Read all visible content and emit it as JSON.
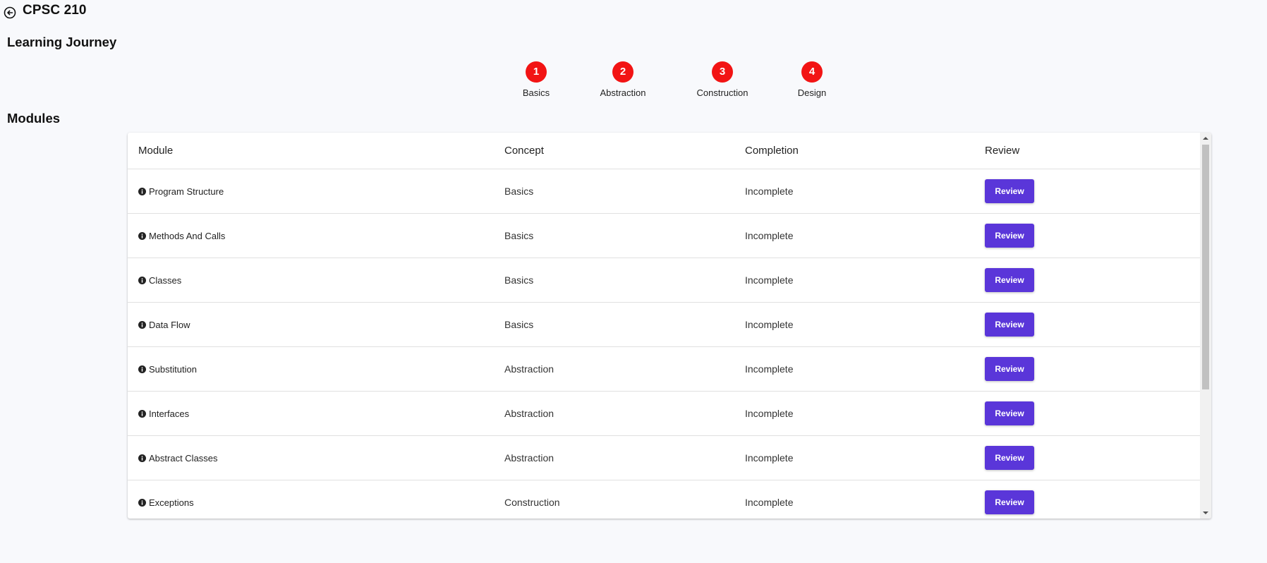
{
  "header": {
    "course_title": "CPSC 210",
    "back_icon": "back-arrow-circle-icon"
  },
  "journey": {
    "title": "Learning Journey",
    "step_color": "#f21414",
    "steps": [
      {
        "number": "1",
        "label": "Basics"
      },
      {
        "number": "2",
        "label": "Abstraction"
      },
      {
        "number": "3",
        "label": "Construction"
      },
      {
        "number": "4",
        "label": "Design"
      }
    ]
  },
  "modules": {
    "title": "Modules",
    "columns": [
      "Module",
      "Concept",
      "Completion",
      "Review"
    ],
    "button_color": "#5a36d9",
    "rows": [
      {
        "module": "Program Structure",
        "concept": "Basics",
        "completion": "Incomplete",
        "review": "Review"
      },
      {
        "module": "Methods And Calls",
        "concept": "Basics",
        "completion": "Incomplete",
        "review": "Review"
      },
      {
        "module": "Classes",
        "concept": "Basics",
        "completion": "Incomplete",
        "review": "Review"
      },
      {
        "module": "Data Flow",
        "concept": "Basics",
        "completion": "Incomplete",
        "review": "Review"
      },
      {
        "module": "Substitution",
        "concept": "Abstraction",
        "completion": "Incomplete",
        "review": "Review"
      },
      {
        "module": "Interfaces",
        "concept": "Abstraction",
        "completion": "Incomplete",
        "review": "Review"
      },
      {
        "module": "Abstract Classes",
        "concept": "Abstraction",
        "completion": "Incomplete",
        "review": "Review"
      },
      {
        "module": "Exceptions",
        "concept": "Construction",
        "completion": "Incomplete",
        "review": "Review"
      }
    ]
  }
}
